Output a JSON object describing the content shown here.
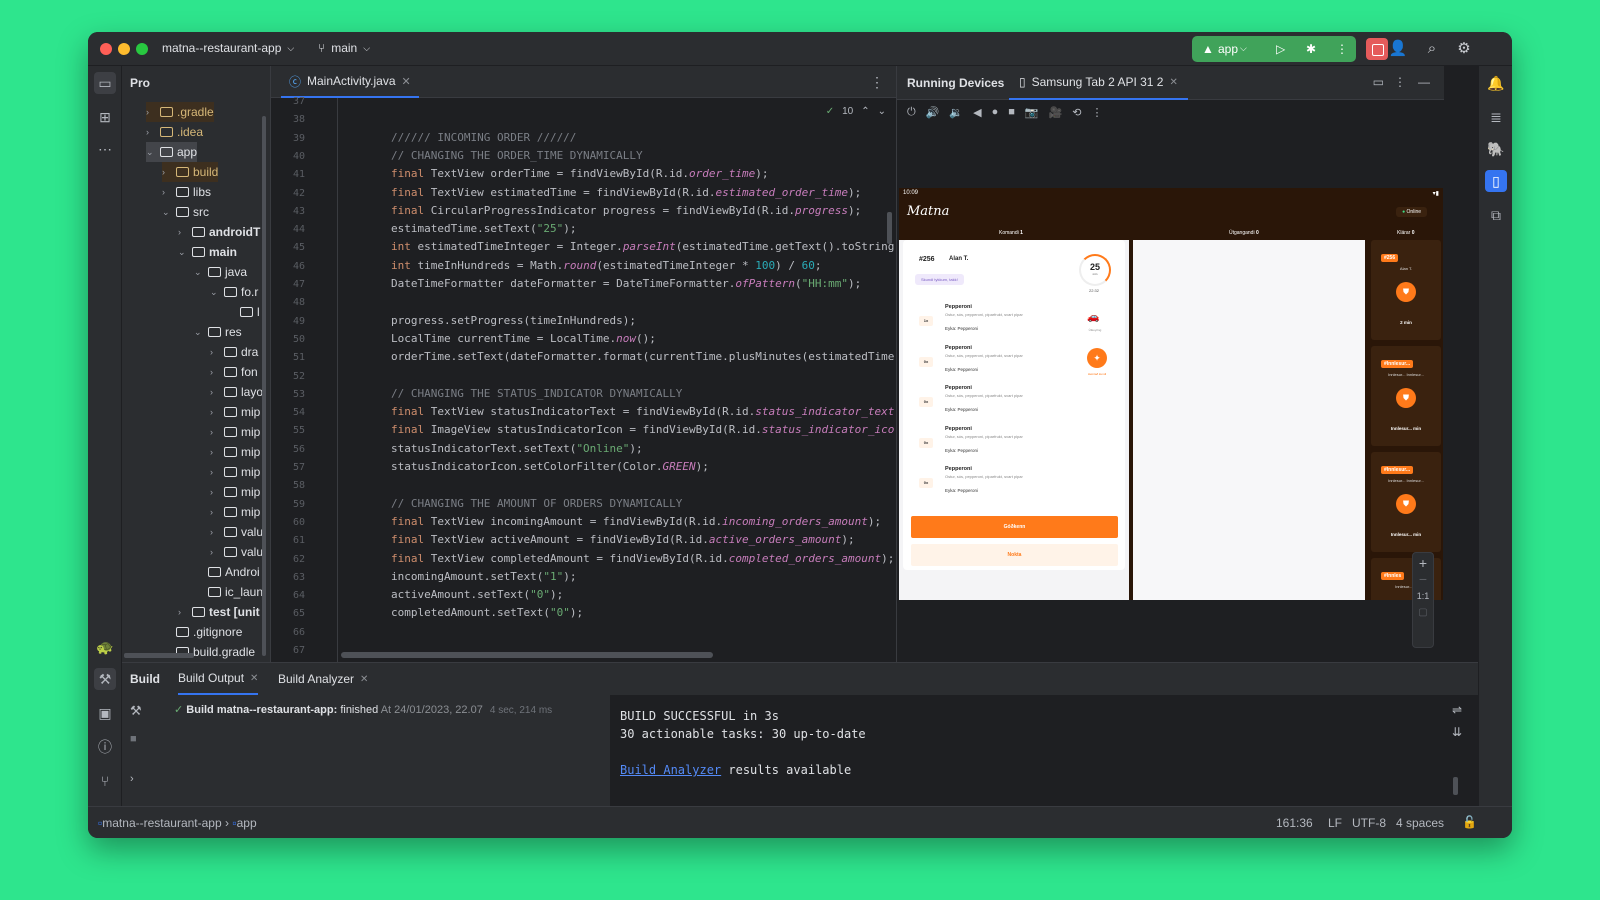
{
  "titlebar": {
    "project": "matna--restaurant-app",
    "branch": "main",
    "run_config": "app"
  },
  "project_panel": {
    "title": "Pro",
    "tree": [
      {
        "label": ".gradle",
        "indent": 1,
        "expanded": false,
        "color": "#d5b778",
        "hl": true
      },
      {
        "label": ".idea",
        "indent": 1,
        "expanded": false,
        "color": "#d5b778",
        "hl": false
      },
      {
        "label": "app",
        "indent": 1,
        "expanded": true,
        "color": "#dfe1e5",
        "hl": false,
        "sel": true
      },
      {
        "label": "build",
        "indent": 2,
        "expanded": false,
        "color": "#d5b778",
        "hl": true
      },
      {
        "label": "libs",
        "indent": 2,
        "expanded": false,
        "color": "#dfe1e5",
        "hl": false
      },
      {
        "label": "src",
        "indent": 2,
        "expanded": true,
        "color": "#dfe1e5",
        "hl": false
      },
      {
        "label": "androidT",
        "indent": 3,
        "expanded": false,
        "color": "#dfe1e5",
        "hl": false,
        "bold": true
      },
      {
        "label": "main",
        "indent": 3,
        "expanded": true,
        "color": "#dfe1e5",
        "hl": false,
        "bold": true
      },
      {
        "label": "java",
        "indent": 4,
        "expanded": true,
        "color": "#dfe1e5",
        "hl": false
      },
      {
        "label": "fo.r",
        "indent": 5,
        "expanded": true,
        "color": "#dfe1e5",
        "hl": false
      },
      {
        "label": "l",
        "indent": 6,
        "expanded": null,
        "color": "#dfe1e5",
        "hl": false
      },
      {
        "label": "res",
        "indent": 4,
        "expanded": true,
        "color": "#dfe1e5",
        "hl": false
      },
      {
        "label": "dra",
        "indent": 5,
        "expanded": false,
        "color": "#dfe1e5",
        "hl": false
      },
      {
        "label": "fon",
        "indent": 5,
        "expanded": false,
        "color": "#dfe1e5",
        "hl": false
      },
      {
        "label": "layo",
        "indent": 5,
        "expanded": false,
        "color": "#dfe1e5",
        "hl": false
      },
      {
        "label": "mip",
        "indent": 5,
        "expanded": false,
        "color": "#dfe1e5",
        "hl": false
      },
      {
        "label": "mip",
        "indent": 5,
        "expanded": false,
        "color": "#dfe1e5",
        "hl": false
      },
      {
        "label": "mip",
        "indent": 5,
        "expanded": false,
        "color": "#dfe1e5",
        "hl": false
      },
      {
        "label": "mip",
        "indent": 5,
        "expanded": false,
        "color": "#dfe1e5",
        "hl": false
      },
      {
        "label": "mip",
        "indent": 5,
        "expanded": false,
        "color": "#dfe1e5",
        "hl": false
      },
      {
        "label": "mip",
        "indent": 5,
        "expanded": false,
        "color": "#dfe1e5",
        "hl": false
      },
      {
        "label": "valu",
        "indent": 5,
        "expanded": false,
        "color": "#dfe1e5",
        "hl": false
      },
      {
        "label": "valu",
        "indent": 5,
        "expanded": false,
        "color": "#dfe1e5",
        "hl": false
      },
      {
        "label": "Androi",
        "indent": 4,
        "expanded": null,
        "color": "#dfe1e5",
        "hl": false
      },
      {
        "label": "ic_laun",
        "indent": 4,
        "expanded": null,
        "color": "#dfe1e5",
        "hl": false
      },
      {
        "label": "test [unit",
        "indent": 3,
        "expanded": false,
        "color": "#dfe1e5",
        "hl": false,
        "bold": true
      },
      {
        "label": ".gitignore",
        "indent": 2,
        "expanded": null,
        "color": "#dfe1e5",
        "hl": false
      },
      {
        "label": "build.gradle",
        "indent": 2,
        "expanded": null,
        "color": "#dfe1e5",
        "hl": false
      }
    ]
  },
  "editor": {
    "tab": "MainActivity.java",
    "inspections": "10",
    "line_numbers": [
      "37",
      "38",
      "39",
      "40",
      "41",
      "42",
      "43",
      "44",
      "45",
      "46",
      "47",
      "48",
      "49",
      "50",
      "51",
      "52",
      "53",
      "54",
      "55",
      "56",
      "57",
      "58",
      "59",
      "60",
      "61",
      "62",
      "63",
      "64",
      "65",
      "66",
      "67"
    ],
    "lines": [
      [],
      [],
      [
        [
          "cm",
          "////// INCOMING ORDER //////"
        ]
      ],
      [
        [
          "cm",
          "// CHANGING THE ORDER_TIME DYNAMICALLY"
        ]
      ],
      [
        [
          "kw",
          "final "
        ],
        [
          "",
          "TextView orderTime = findViewById(R.id."
        ],
        [
          "it",
          "order_time"
        ],
        [
          "",
          ");"
        ]
      ],
      [
        [
          "kw",
          "final "
        ],
        [
          "",
          "TextView estimatedTime = findViewById(R.id."
        ],
        [
          "it",
          "estimated_order_time"
        ],
        [
          "",
          ");"
        ]
      ],
      [
        [
          "kw",
          "final "
        ],
        [
          "",
          "CircularProgressIndicator progress = findViewById(R.id."
        ],
        [
          "it",
          "progress"
        ],
        [
          "",
          ");"
        ]
      ],
      [
        [
          "",
          "estimatedTime.setText("
        ],
        [
          "str",
          "\"25\""
        ],
        [
          "",
          ");"
        ]
      ],
      [
        [
          "kw",
          "int "
        ],
        [
          "",
          "estimatedTimeInteger = Integer."
        ],
        [
          "it",
          "parseInt"
        ],
        [
          "",
          "(estimatedTime.getText().toString"
        ]
      ],
      [
        [
          "kw",
          "int "
        ],
        [
          "",
          "timeInHundreds = Math."
        ],
        [
          "it",
          "round"
        ],
        [
          "",
          "(estimatedTimeInteger * "
        ],
        [
          "num",
          "100"
        ],
        [
          "",
          ") / "
        ],
        [
          "num",
          "60"
        ],
        [
          "",
          ";"
        ]
      ],
      [
        [
          "",
          "DateTimeFormatter dateFormatter = DateTimeFormatter."
        ],
        [
          "it",
          "ofPattern"
        ],
        [
          "",
          "("
        ],
        [
          "str",
          "\"HH:mm\""
        ],
        [
          "",
          ");"
        ]
      ],
      [],
      [
        [
          "",
          "progress.setProgress(timeInHundreds);"
        ]
      ],
      [
        [
          "",
          "LocalTime currentTime = LocalTime."
        ],
        [
          "it",
          "now"
        ],
        [
          "",
          "();"
        ]
      ],
      [
        [
          "",
          "orderTime.setText(dateFormatter.format(currentTime.plusMinutes(estimatedTime"
        ]
      ],
      [],
      [
        [
          "cm",
          "// CHANGING THE STATUS_INDICATOR DYNAMICALLY"
        ]
      ],
      [
        [
          "kw",
          "final "
        ],
        [
          "",
          "TextView statusIndicatorText = findViewById(R.id."
        ],
        [
          "it",
          "status_indicator_text"
        ]
      ],
      [
        [
          "kw",
          "final "
        ],
        [
          "",
          "ImageView statusIndicatorIcon = findViewById(R.id."
        ],
        [
          "it",
          "status_indicator_ico"
        ]
      ],
      [
        [
          "",
          "statusIndicatorText.setText("
        ],
        [
          "str",
          "\"Online\""
        ],
        [
          "",
          ");"
        ]
      ],
      [
        [
          "",
          "statusIndicatorIcon.setColorFilter(Color."
        ],
        [
          "it",
          "GREEN"
        ],
        [
          "",
          ");"
        ]
      ],
      [],
      [
        [
          "cm",
          "// CHANGING THE AMOUNT OF ORDERS DYNAMICALLY"
        ]
      ],
      [
        [
          "kw",
          "final "
        ],
        [
          "",
          "TextView incomingAmount = findViewById(R.id."
        ],
        [
          "it",
          "incoming_orders_amount"
        ],
        [
          "",
          ");"
        ]
      ],
      [
        [
          "kw",
          "final "
        ],
        [
          "",
          "TextView activeAmount = findViewById(R.id."
        ],
        [
          "it",
          "active_orders_amount"
        ],
        [
          "",
          ");"
        ]
      ],
      [
        [
          "kw",
          "final "
        ],
        [
          "",
          "TextView completedAmount = findViewById(R.id."
        ],
        [
          "it",
          "completed_orders_amount"
        ],
        [
          "",
          ");"
        ]
      ],
      [
        [
          "",
          "incomingAmount.setText("
        ],
        [
          "str",
          "\"1\""
        ],
        [
          "",
          ");"
        ]
      ],
      [
        [
          "",
          "activeAmount.setText("
        ],
        [
          "str",
          "\"0\""
        ],
        [
          "",
          ");"
        ]
      ],
      [
        [
          "",
          "completedAmount.setText("
        ],
        [
          "str",
          "\"0\""
        ],
        [
          "",
          ");"
        ]
      ],
      [],
      []
    ]
  },
  "running_devices": {
    "title": "Running Devices",
    "device_tab": "Samsung Tab 2 API 31 2",
    "zoom_label": "1:1"
  },
  "app_screen": {
    "time": "10:09",
    "logo": "Matna",
    "status": "Online",
    "tabs": [
      {
        "label": "Komandi",
        "count": "1"
      },
      {
        "label": "Útgangandi",
        "count": "0"
      },
      {
        "label": "Klárar",
        "count": "0"
      }
    ],
    "order": {
      "number": "#256",
      "customer": "Alan T.",
      "note": "Skundi tykkum, takk!",
      "minutes": "25",
      "min_unit": "min",
      "eta": "22:32",
      "items": [
        {
          "qty": "1x",
          "name": "Pepperoni",
          "desc": "Ostur, sós, pepperoni, piparfrukt, svart pipar",
          "extra": "Eyka: Pepperoni"
        },
        {
          "qty": "0x",
          "name": "Pepperoni",
          "desc": "Ostur, sós, pepperoni, piparfrukt, svart pipar",
          "extra": "Eyka: Pepperoni"
        },
        {
          "qty": "0x",
          "name": "Pepperoni",
          "desc": "Ostur, sós, pepperoni, piparfrukt, svart pipar",
          "extra": "Eyka: Pepperoni"
        },
        {
          "qty": "0x",
          "name": "Pepperoni",
          "desc": "Ostur, sós, pepperoni, piparfrukt, svart pipar",
          "extra": "Eyka: Pepperoni"
        },
        {
          "qty": "0x",
          "name": "Pepperoni",
          "desc": "Ostur, sós, pepperoni, piparfrukt, svart pipar",
          "extra": "Eyka: Pepperoni"
        }
      ],
      "delivery_label": "Útkoyring",
      "pickup_label": "Heintað kundi",
      "accept": "Góðkenn",
      "reject": "Nokta"
    },
    "side_cards": [
      {
        "num": "#256",
        "name": "Alan T.",
        "time": "2 min"
      },
      {
        "num": "#Innlesur...",
        "name": "Innlesur... Innlesur...",
        "time": "Innlesur... min"
      },
      {
        "num": "#Innlesur...",
        "name": "Innlesur... Innlesur...",
        "time": "Innlesur... min"
      },
      {
        "num": "#Innles",
        "name": "Innlesur... In",
        "time": ""
      }
    ]
  },
  "build": {
    "tab_build": "Build",
    "tab_output": "Build Output",
    "tab_analyzer": "Build Analyzer",
    "result_bold": "Build matna--restaurant-app:",
    "result_status": "finished",
    "result_time": "At 24/01/2023, 22.07",
    "result_duration": "4 sec, 214 ms",
    "out1": "BUILD SUCCESSFUL in 3s",
    "out2": "30 actionable tasks: 30 up-to-date",
    "out_link": "Build Analyzer",
    "out_rest": " results available"
  },
  "statusbar": {
    "crumb1": "matna--restaurant-app",
    "crumb2": "app",
    "position": "161:36",
    "line_sep": "LF",
    "encoding": "UTF-8",
    "indent": "4 spaces"
  },
  "colors": {
    "accent": "#3574f0",
    "run": "#40a35a",
    "stop": "#e55b5b",
    "app_orange": "#ff7a1a",
    "app_brown": "#2a1608"
  }
}
